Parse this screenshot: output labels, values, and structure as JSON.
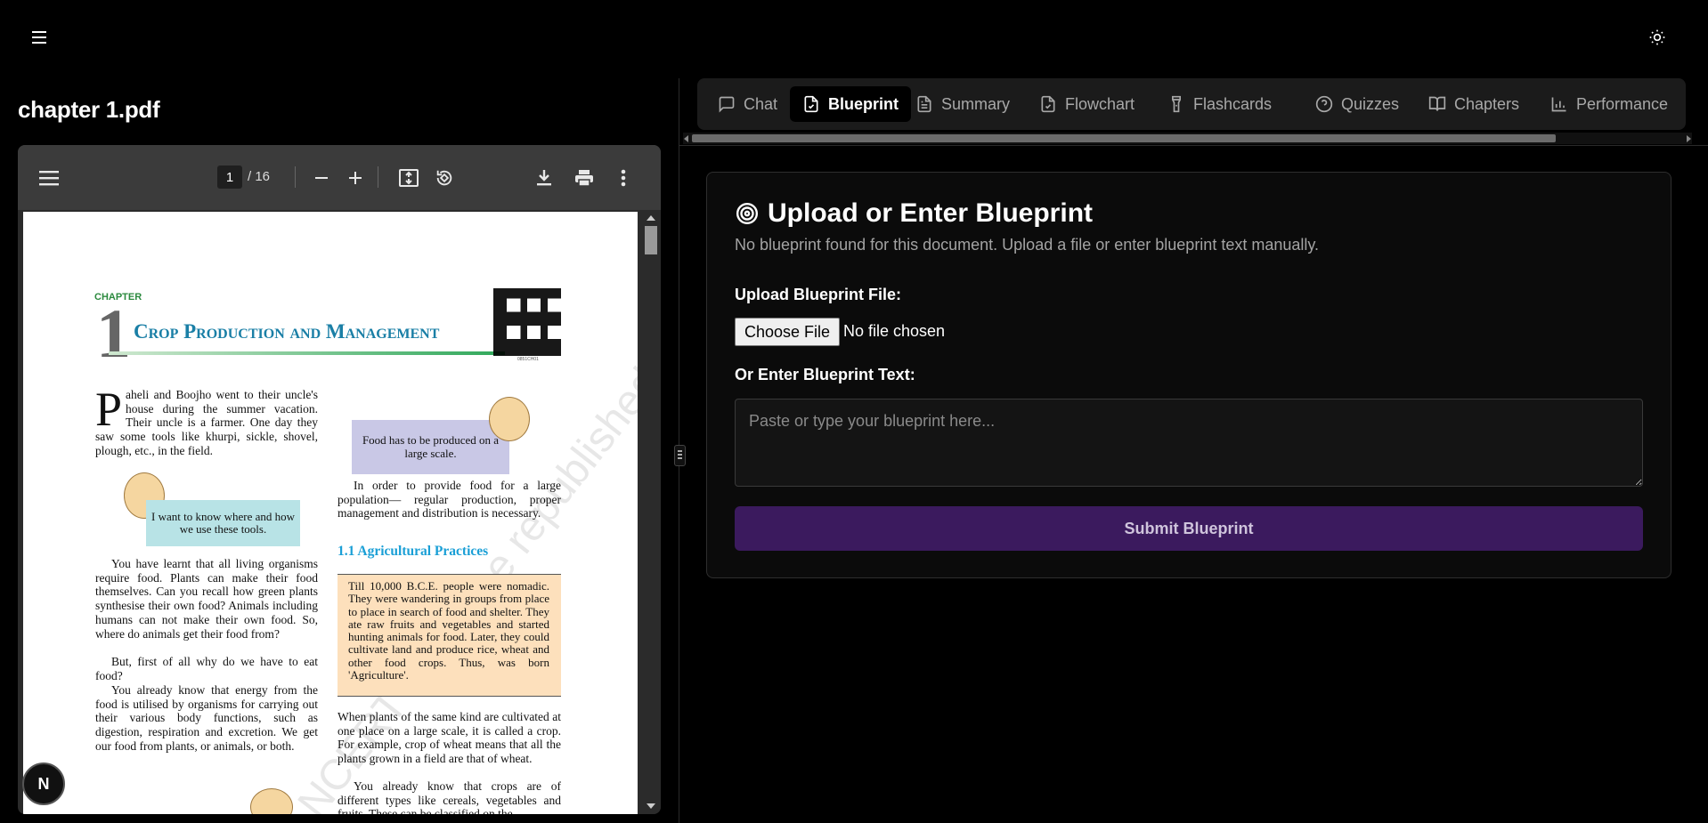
{
  "app": {
    "menu_icon": "hamburger-icon",
    "theme_icon": "sun-icon"
  },
  "pdf": {
    "filename": "chapter 1.pdf",
    "toolbar": {
      "current_page": "1",
      "total_pages": "/ 16"
    },
    "page": {
      "chapter_label": "CHAPTER",
      "chapter_number": "1",
      "chapter_title": "Crop Production and Management",
      "qr_code_text": "0851CH01",
      "intro_dropcap": "P",
      "intro_text": "aheli and Boojho went to their uncle's house during the summer vacation. Their uncle is a farmer. One day they saw some tools like khurpi, sickle, shovel, plough, etc., in the field.",
      "callout_1": "Food has to be produced on a large scale.",
      "callout_2": "I want to know where and how we use these tools.",
      "para_right_1": "In order to provide food for a large population— regular production, proper management and distribution is necessary.",
      "section_heading": "1.1 Agricultural Practices",
      "history_box": "Till 10,000 B.C.E. people were nomadic. They were wandering in groups from place to place in search of food and shelter. They ate raw fruits and vegetables and started hunting animals for food. Later, they could cultivate land and produce rice, wheat and other food crops. Thus, was born 'Agriculture'.",
      "para_left_1": "You have learnt that all living organisms require food. Plants can make their food themselves. Can you recall how green plants synthesise their own food? Animals including humans can not make their own food. So, where do animals get their food from?",
      "para_left_2": "But, first of all why do we have to eat food?",
      "para_left_3": "You already know that energy from the food is utilised by organisms for carrying out their various body functions, such as digestion, respiration and excretion. We get our food from plants, or animals, or both.",
      "para_right_2": "When plants of the same kind are cultivated at one place on a large scale, it is called a crop. For example, crop of wheat means that all the plants grown in a field are that of wheat.",
      "para_right_3": "You already know that crops are of different types like cereals, vegetables and fruits. These can be classified on the",
      "watermark": "© NCERT not to be republished"
    },
    "badge_letter": "N"
  },
  "tabs": [
    {
      "label": "Chat",
      "icon": "chat-icon"
    },
    {
      "label": "Blueprint",
      "icon": "file-check-icon"
    },
    {
      "label": "Summary",
      "icon": "file-text-icon"
    },
    {
      "label": "Flowchart",
      "icon": "file-check-icon"
    },
    {
      "label": "Flashcards",
      "icon": "flashlight-icon"
    },
    {
      "label": "Quizzes",
      "icon": "help-circle-icon"
    },
    {
      "label": "Chapters",
      "icon": "book-open-icon"
    },
    {
      "label": "Performance",
      "icon": "bar-chart-icon"
    }
  ],
  "active_tab": "Blueprint",
  "blueprint": {
    "title": "Upload or Enter Blueprint",
    "title_icon": "target-icon",
    "description": "No blueprint found for this document. Upload a file or enter blueprint text manually.",
    "upload_label": "Upload Blueprint File:",
    "choose_file": "Choose File",
    "file_status": "No file chosen",
    "text_label": "Or Enter Blueprint Text:",
    "text_placeholder": "Paste or type your blueprint here...",
    "text_value": "",
    "submit_label": "Submit Blueprint"
  },
  "colors": {
    "background": "#000000",
    "submit_button": "#3b1a5e",
    "section_heading": "#1a9fd6",
    "chapter_title": "#1a7fa6",
    "history_box": "#fde0bc",
    "callout_1": "#c9c8e6",
    "callout_2": "#b8e3e6"
  }
}
